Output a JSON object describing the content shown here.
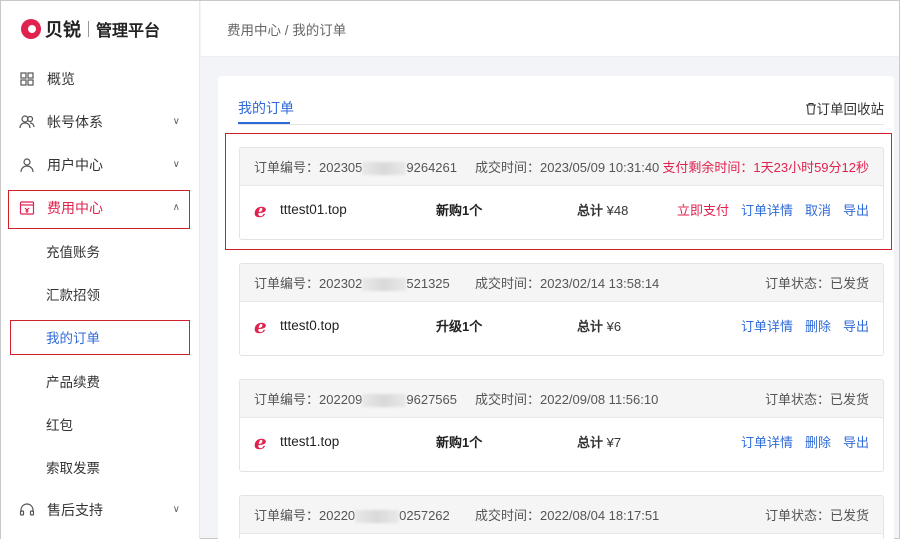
{
  "brand": {
    "name": "贝锐",
    "sub": "管理平台"
  },
  "sidebar": {
    "items": [
      {
        "label": "概览",
        "icon": "grid-icon"
      },
      {
        "label": "帐号体系",
        "icon": "users-icon"
      },
      {
        "label": "用户中心",
        "icon": "user-icon"
      },
      {
        "label": "费用中心",
        "icon": "wallet-icon"
      },
      {
        "label": "售后支持",
        "icon": "headset-icon"
      }
    ],
    "sub_items": [
      "充值账务",
      "汇款招领",
      "我的订单",
      "产品续费",
      "红包",
      "索取发票"
    ]
  },
  "breadcrumb": "费用中心 / 我的订单",
  "tabs": {
    "active": "我的订单",
    "recycle": "订单回收站"
  },
  "orders": [
    {
      "no_prefix": "订单编号：202305",
      "no_suffix": "9264261",
      "time": "成交时间：2023/05/09 10:31:40",
      "status": "支付剩余时间：1天23小时59分12秒",
      "domain": "tttest01.top",
      "type": "新购1个",
      "total_label": "总计",
      "total": "¥48",
      "actions": [
        "立即支付",
        "订单详情",
        "取消",
        "导出"
      ]
    },
    {
      "no_prefix": "订单编号：202302",
      "no_suffix": "521325",
      "time": "成交时间：2023/02/14 13:58:14",
      "status": "订单状态：已发货",
      "domain": "tttest0.top",
      "type": "升级1个",
      "total_label": "总计",
      "total": "¥6",
      "actions": [
        "订单详情",
        "删除",
        "导出"
      ]
    },
    {
      "no_prefix": "订单编号：202209",
      "no_suffix": "9627565",
      "time": "成交时间：2022/09/08 11:56:10",
      "status": "订单状态：已发货",
      "domain": "tttest1.top",
      "type": "新购1个",
      "total_label": "总计",
      "total": "¥7",
      "actions": [
        "订单详情",
        "删除",
        "导出"
      ]
    },
    {
      "no_prefix": "订单编号：20220",
      "no_suffix": "0257262",
      "time": "成交时间：2022/08/04 18:17:51",
      "status": "订单状态：已发货"
    }
  ],
  "colors": {
    "accent": "#e0224f",
    "link": "#2f6bd8",
    "highlight": "#d0202a"
  }
}
